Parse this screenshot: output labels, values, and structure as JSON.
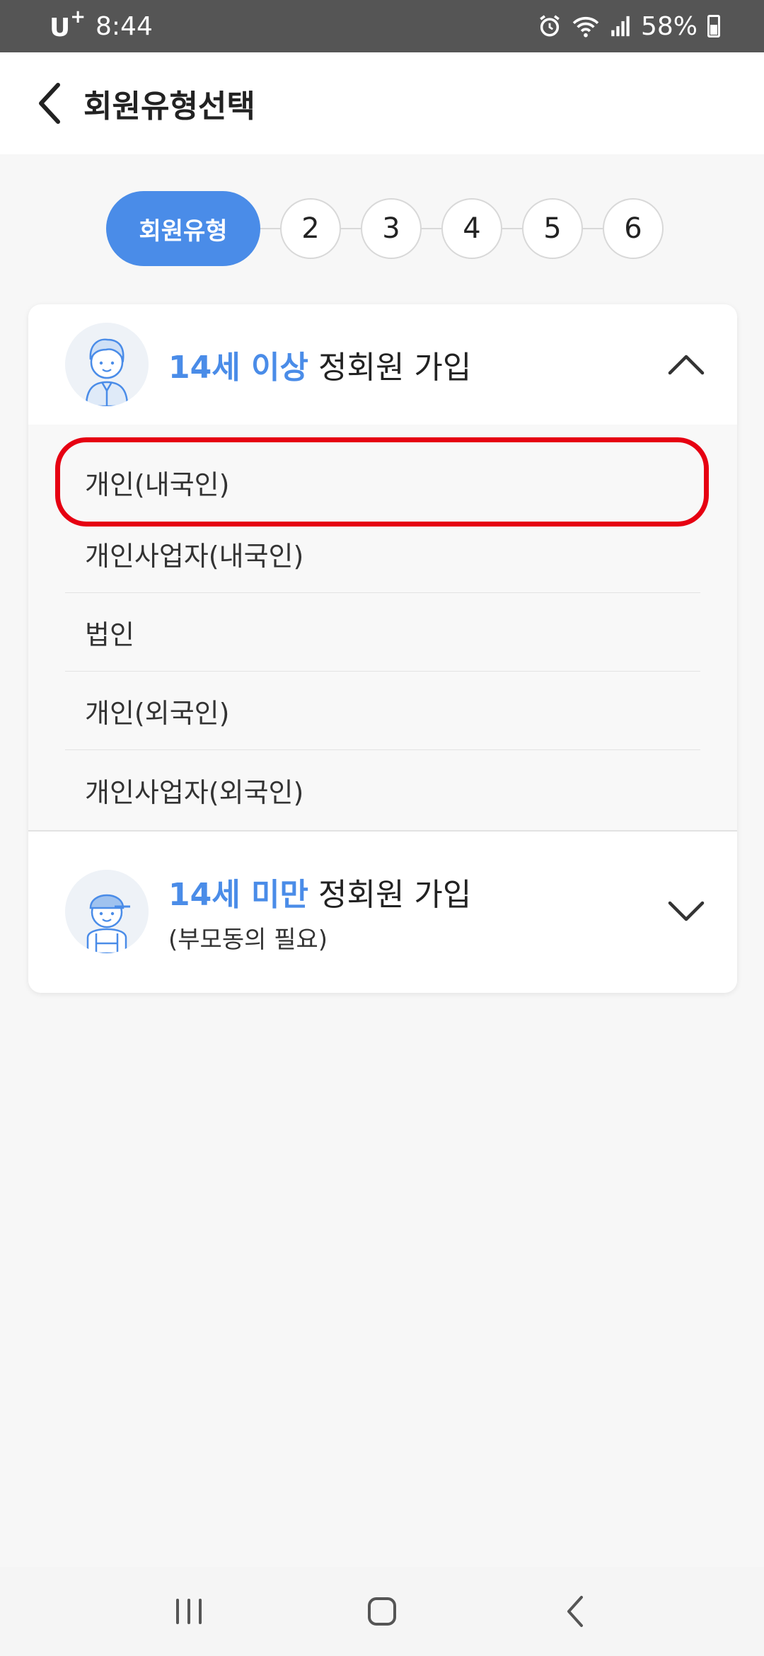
{
  "status_bar": {
    "carrier": "U",
    "carrier_sup": "+",
    "time": "8:44",
    "battery": "58%"
  },
  "header": {
    "title": "회원유형선택"
  },
  "stepper": {
    "active_label": "회원유형",
    "steps": [
      "2",
      "3",
      "4",
      "5",
      "6"
    ]
  },
  "sections": [
    {
      "title_accent": "14세 이상",
      "title_rest": "정회원 가입",
      "subtitle": "",
      "expanded": true,
      "options": [
        "개인(내국인)",
        "개인사업자(내국인)",
        "법인",
        "개인(외국인)",
        "개인사업자(외국인)"
      ]
    },
    {
      "title_accent": "14세 미만",
      "title_rest": "정회원 가입",
      "subtitle": "(부모동의 필요)",
      "expanded": false
    }
  ],
  "colors": {
    "accent": "#4a8ce8",
    "highlight": "#e60012"
  }
}
